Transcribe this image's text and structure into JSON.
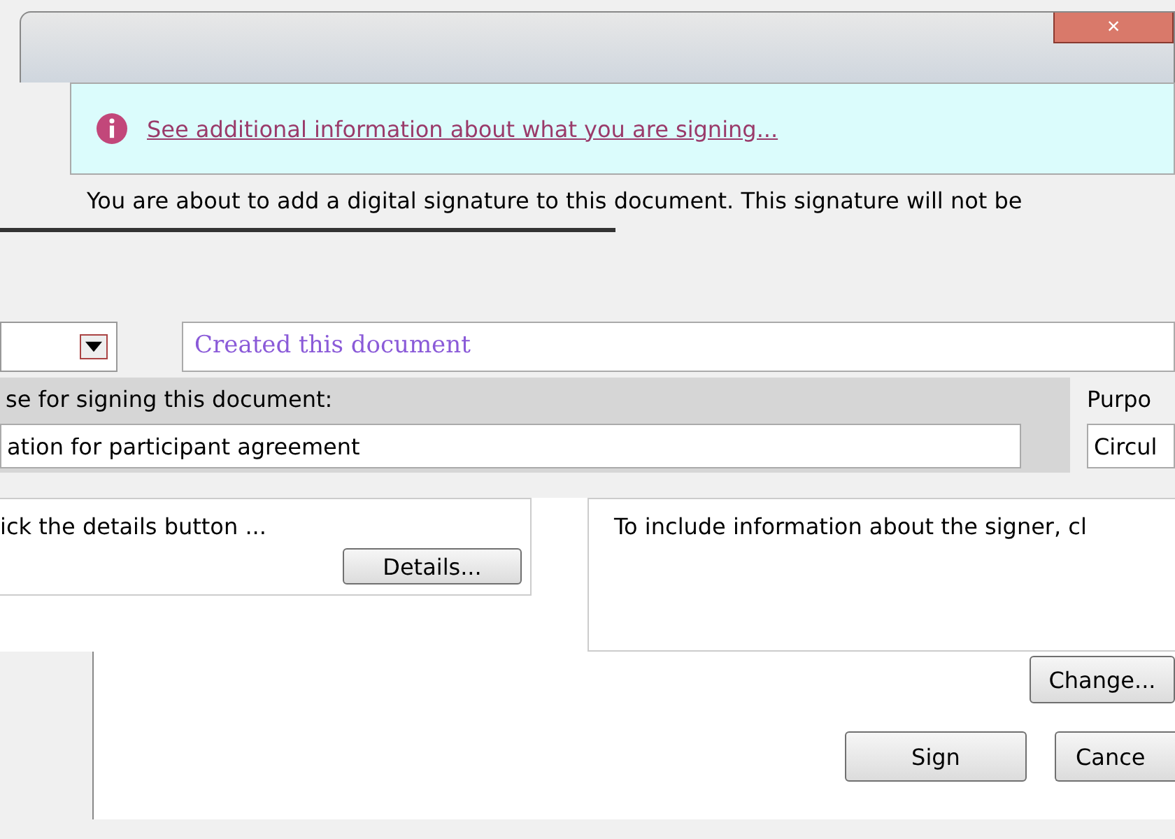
{
  "window": {
    "close_button": "×"
  },
  "info_bar": {
    "link": "See additional information about what you are signing..."
  },
  "intro": "You are about to add a digital signature to this document. This signature will not be",
  "commitment": {
    "value": "Created this document"
  },
  "purpose": {
    "label": "se for signing this document:",
    "value": "ation for participant agreement"
  },
  "purpose_side": {
    "label": "Purpo",
    "value": "Circul"
  },
  "details": {
    "hint": "ick the details button ...",
    "button": "Details...",
    "signer_hint": "To include information about the signer, cl"
  },
  "buttons": {
    "change": "Change...",
    "sign": "Sign",
    "cancel": "Cance"
  }
}
